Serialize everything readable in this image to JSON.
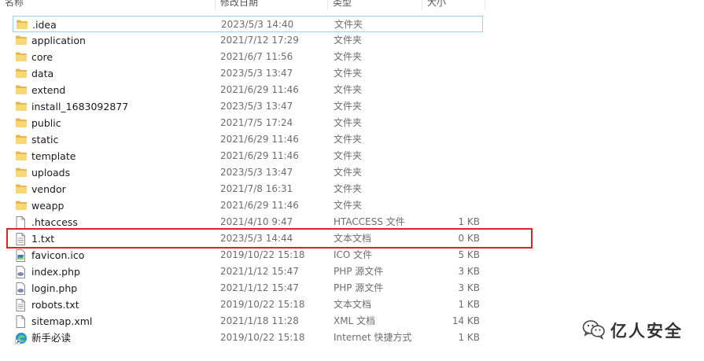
{
  "header": {
    "col_name": "名称",
    "col_date": "修改日期",
    "col_type": "类型",
    "col_size": "大小"
  },
  "files": [
    {
      "name": ".idea",
      "date": "2023/5/3 14:40",
      "type": "文件夹",
      "size": "",
      "icon": "folder-icon"
    },
    {
      "name": "application",
      "date": "2021/7/12 17:29",
      "type": "文件夹",
      "size": "",
      "icon": "folder-icon"
    },
    {
      "name": "core",
      "date": "2021/6/7 11:56",
      "type": "文件夹",
      "size": "",
      "icon": "folder-icon"
    },
    {
      "name": "data",
      "date": "2023/5/3 13:47",
      "type": "文件夹",
      "size": "",
      "icon": "folder-icon"
    },
    {
      "name": "extend",
      "date": "2021/6/29 11:46",
      "type": "文件夹",
      "size": "",
      "icon": "folder-icon"
    },
    {
      "name": "install_1683092877",
      "date": "2023/5/3 13:47",
      "type": "文件夹",
      "size": "",
      "icon": "folder-icon"
    },
    {
      "name": "public",
      "date": "2021/7/5 17:24",
      "type": "文件夹",
      "size": "",
      "icon": "folder-icon"
    },
    {
      "name": "static",
      "date": "2021/6/29 11:46",
      "type": "文件夹",
      "size": "",
      "icon": "folder-icon"
    },
    {
      "name": "template",
      "date": "2021/6/29 11:46",
      "type": "文件夹",
      "size": "",
      "icon": "folder-icon"
    },
    {
      "name": "uploads",
      "date": "2023/5/3 13:47",
      "type": "文件夹",
      "size": "",
      "icon": "folder-icon"
    },
    {
      "name": "vendor",
      "date": "2021/7/8 16:31",
      "type": "文件夹",
      "size": "",
      "icon": "folder-icon"
    },
    {
      "name": "weapp",
      "date": "2021/6/29 11:46",
      "type": "文件夹",
      "size": "",
      "icon": "folder-icon"
    },
    {
      "name": ".htaccess",
      "date": "2021/4/10 9:47",
      "type": "HTACCESS 文件",
      "size": "1 KB",
      "icon": "blank-file-icon"
    },
    {
      "name": "1.txt",
      "date": "2023/5/3 14:44",
      "type": "文本文档",
      "size": "0 KB",
      "icon": "text-file-icon"
    },
    {
      "name": "favicon.ico",
      "date": "2019/10/22 15:18",
      "type": "ICO 文件",
      "size": "5 KB",
      "icon": "image-file-icon"
    },
    {
      "name": "index.php",
      "date": "2021/1/12 15:47",
      "type": "PHP 源文件",
      "size": "3 KB",
      "icon": "php-file-icon"
    },
    {
      "name": "login.php",
      "date": "2021/1/12 15:47",
      "type": "PHP 源文件",
      "size": "3 KB",
      "icon": "php-file-icon"
    },
    {
      "name": "robots.txt",
      "date": "2019/10/22 15:18",
      "type": "文本文档",
      "size": "1 KB",
      "icon": "text-file-icon"
    },
    {
      "name": "sitemap.xml",
      "date": "2021/1/18 11:28",
      "type": "XML 文档",
      "size": "14 KB",
      "icon": "blank-file-icon"
    },
    {
      "name": "新手必读",
      "date": "2019/10/22 15:18",
      "type": "Internet 快捷方式",
      "size": "1 KB",
      "icon": "edge-shortcut-icon"
    }
  ],
  "watermark": {
    "text": "亿人安全",
    "icon": "wechat-icon"
  },
  "colors": {
    "highlight": "#d9252a",
    "focus_border": "#99d1f5",
    "folder": "#f8d775"
  }
}
